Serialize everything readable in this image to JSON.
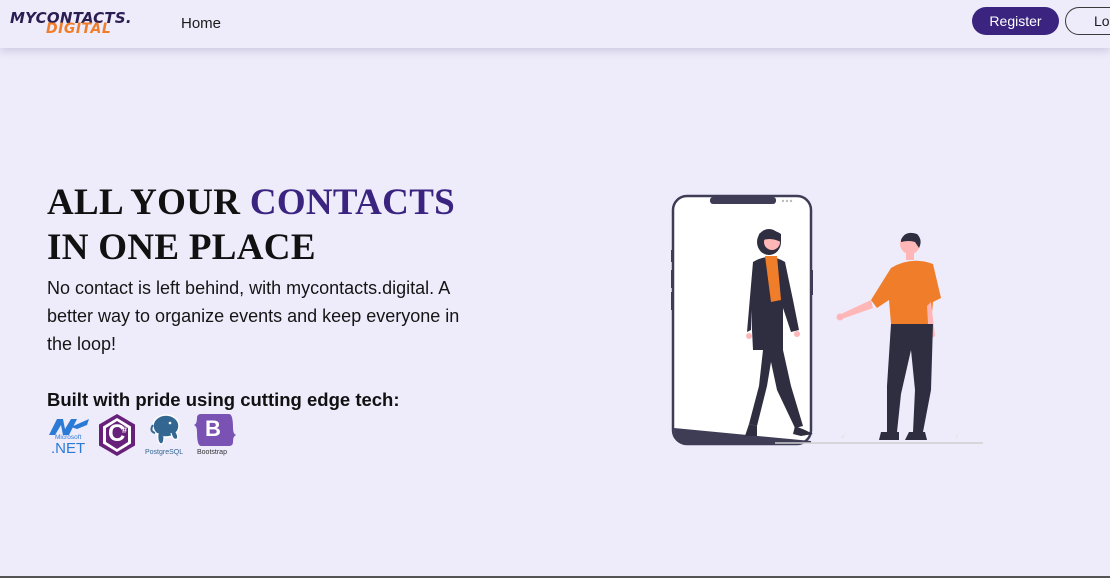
{
  "navbar": {
    "logo_line1": "MYCONTACTS.",
    "logo_line2": "DIGITAL",
    "home_link": "Home",
    "register_button": "Register",
    "login_button": "Login"
  },
  "hero": {
    "title_part1": "ALL YOUR ",
    "title_accent": "CONTACTS",
    "title_line2": "IN ONE PLACE",
    "description": "No contact is left behind, with mycontacts.digital. A better way to organize events and keep everyone in the loop!",
    "tech_heading": "Built with pride using cutting edge tech:"
  },
  "tech_logos": {
    "dotnet": {
      "small": "Microsoft",
      "big": ".NET"
    },
    "csharp": {
      "glyph": "C",
      "sup": "#"
    },
    "postgres": {
      "caption": "PostgreSQL"
    },
    "bootstrap": {
      "glyph": "B",
      "caption": "Bootstrap"
    }
  },
  "colors": {
    "background": "#eeebfb",
    "brand_purple": "#3a2480",
    "brand_orange": "#f07d2a"
  },
  "icons": [
    "dotnet-logo-icon",
    "csharp-logo-icon",
    "postgresql-logo-icon",
    "bootstrap-logo-icon",
    "phone-illustration"
  ]
}
